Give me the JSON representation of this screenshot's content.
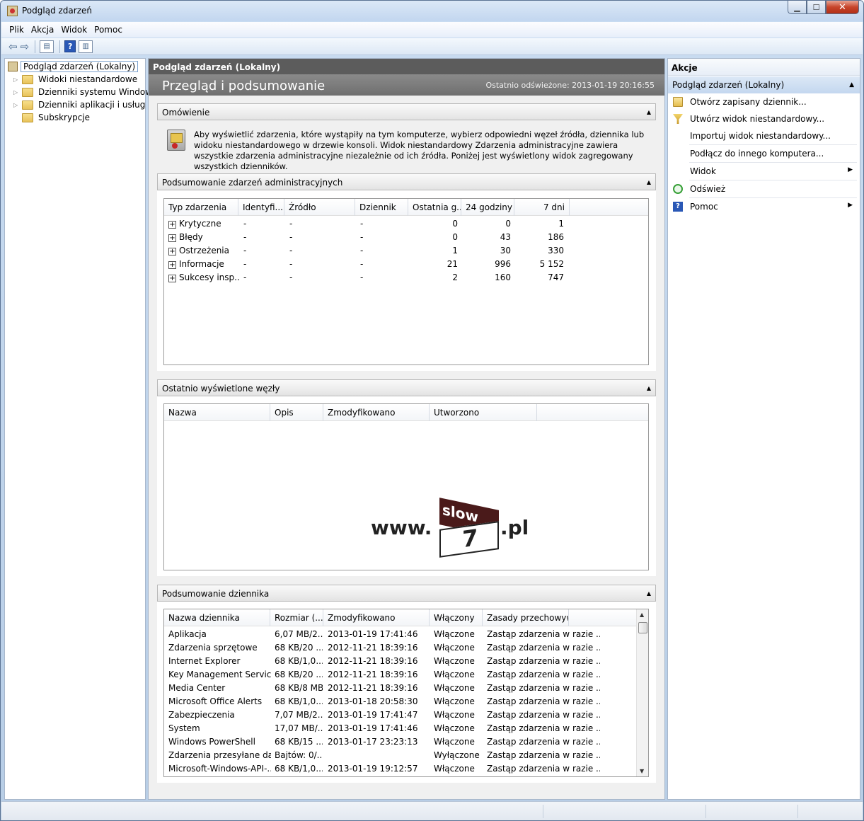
{
  "window": {
    "title": "Podgląd zdarzeń",
    "minimize": "▁",
    "maximize": "☐",
    "close": "✕"
  },
  "menu": [
    {
      "label": "Plik"
    },
    {
      "label": "Akcja"
    },
    {
      "label": "Widok"
    },
    {
      "label": "Pomoc"
    }
  ],
  "toolbar": {
    "back_icon": "arrow-left-icon",
    "forward_icon": "arrow-right-icon",
    "back": "⇦",
    "forward": "⇨",
    "help": "?"
  },
  "tree": {
    "root": "Podgląd zdarzeń (Lokalny)",
    "items": [
      {
        "label": "Widoki niestandardowe"
      },
      {
        "label": "Dzienniki systemu Windows"
      },
      {
        "label": "Dzienniki aplikacji i usług"
      },
      {
        "label": "Subskrypcje"
      }
    ]
  },
  "center": {
    "header": "Podgląd zdarzeń (Lokalny)",
    "banner_title": "Przegląd i podsumowanie",
    "last_refreshed": "Ostatnio odświeżone: 2013-01-19 20:16:55",
    "overview": {
      "title": "Omówienie",
      "text": "Aby wyświetlić zdarzenia, które wystąpiły na tym komputerze, wybierz odpowiedni węzeł źródła, dziennika lub widoku niestandardowego w drzewie konsoli. Widok niestandardowy Zdarzenia administracyjne zawiera wszystkie zdarzenia administracyjne niezależnie od ich źródła. Poniżej jest wyświetlony widok zagregowany wszystkich dzienników."
    },
    "admin_summary": {
      "title": "Podsumowanie zdarzeń administracyjnych",
      "columns": [
        "Typ zdarzenia",
        "Identyfi...",
        "Źródło",
        "Dziennik",
        "Ostatnia g...",
        "24 godziny",
        "7 dni"
      ],
      "rows": [
        {
          "type": "Krytyczne",
          "id": "-",
          "source": "-",
          "log": "-",
          "hour": "0",
          "day": "0",
          "week": "1"
        },
        {
          "type": "Błędy",
          "id": "-",
          "source": "-",
          "log": "-",
          "hour": "0",
          "day": "43",
          "week": "186"
        },
        {
          "type": "Ostrzeżenia",
          "id": "-",
          "source": "-",
          "log": "-",
          "hour": "1",
          "day": "30",
          "week": "330"
        },
        {
          "type": "Informacje",
          "id": "-",
          "source": "-",
          "log": "-",
          "hour": "21",
          "day": "996",
          "week": "5 152"
        },
        {
          "type": "Sukcesy insp...",
          "id": "-",
          "source": "-",
          "log": "-",
          "hour": "2",
          "day": "160",
          "week": "747"
        }
      ]
    },
    "recent_nodes": {
      "title": "Ostatnio wyświetlone węzły",
      "columns": [
        "Nazwa",
        "Opis",
        "Zmodyfikowano",
        "Utworzono"
      ],
      "logo": {
        "www": "www.",
        "flag": "slow",
        "number": "7",
        "pl": ".pl"
      }
    },
    "log_summary": {
      "title": "Podsumowanie dziennika",
      "columns": [
        "Nazwa dziennika",
        "Rozmiar (...",
        "Zmodyfikowano",
        "Włączony",
        "Zasady przechowywania"
      ],
      "rows": [
        {
          "name": "Aplikacja",
          "size": "6,07 MB/2...",
          "modified": "2013-01-19 17:41:46",
          "enabled": "Włączone",
          "policy": "Zastąp zdarzenia w razie ..."
        },
        {
          "name": "Zdarzenia sprzętowe",
          "size": "68 KB/20 ...",
          "modified": "2012-11-21 18:39:16",
          "enabled": "Włączone",
          "policy": "Zastąp zdarzenia w razie ..."
        },
        {
          "name": "Internet Explorer",
          "size": "68 KB/1,0...",
          "modified": "2012-11-21 18:39:16",
          "enabled": "Włączone",
          "policy": "Zastąp zdarzenia w razie ..."
        },
        {
          "name": "Key Management Service",
          "size": "68 KB/20 ...",
          "modified": "2012-11-21 18:39:16",
          "enabled": "Włączone",
          "policy": "Zastąp zdarzenia w razie ..."
        },
        {
          "name": "Media Center",
          "size": "68 KB/8 MB",
          "modified": "2012-11-21 18:39:16",
          "enabled": "Włączone",
          "policy": "Zastąp zdarzenia w razie ..."
        },
        {
          "name": "Microsoft Office Alerts",
          "size": "68 KB/1,0...",
          "modified": "2013-01-18 20:58:30",
          "enabled": "Włączone",
          "policy": "Zastąp zdarzenia w razie ..."
        },
        {
          "name": "Zabezpieczenia",
          "size": "7,07 MB/2...",
          "modified": "2013-01-19 17:41:47",
          "enabled": "Włączone",
          "policy": "Zastąp zdarzenia w razie ..."
        },
        {
          "name": "System",
          "size": "17,07 MB/...",
          "modified": "2013-01-19 17:41:46",
          "enabled": "Włączone",
          "policy": "Zastąp zdarzenia w razie ..."
        },
        {
          "name": "Windows PowerShell",
          "size": "68 KB/15 ...",
          "modified": "2013-01-17 23:23:13",
          "enabled": "Włączone",
          "policy": "Zastąp zdarzenia w razie ..."
        },
        {
          "name": "Zdarzenia przesyłane dalej",
          "size": "Bajtów: 0/...",
          "modified": "",
          "enabled": "Wyłączone",
          "policy": "Zastąp zdarzenia w razie ..."
        },
        {
          "name": "Microsoft-Windows-API-...",
          "size": "68 KB/1,0...",
          "modified": "2013-01-19 19:12:57",
          "enabled": "Włączone",
          "policy": "Zastąp zdarzenia w razie ..."
        }
      ]
    }
  },
  "actions": {
    "title": "Akcje",
    "section": "Podgląd zdarzeń (Lokalny)",
    "items": [
      {
        "label": "Otwórz zapisany dziennik...",
        "icon": "open-folder-icon"
      },
      {
        "label": "Utwórz widok niestandardowy...",
        "icon": "filter-icon"
      },
      {
        "label": "Importuj widok niestandardowy..."
      },
      {
        "label": "Podłącz do innego komputera..."
      },
      {
        "label": "Widok"
      },
      {
        "label": "Odśwież",
        "icon": "refresh-icon"
      },
      {
        "label": "Pomoc",
        "icon": "help-icon"
      }
    ]
  }
}
